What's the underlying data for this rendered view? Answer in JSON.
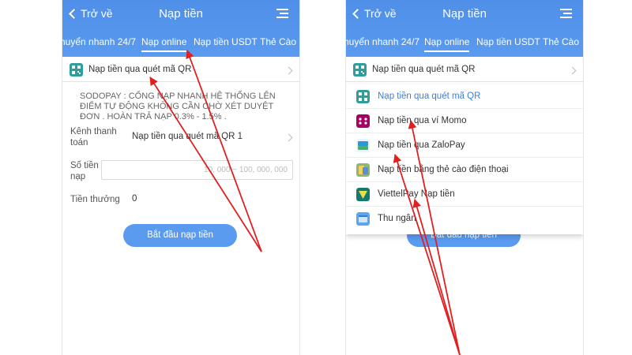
{
  "left": {
    "header": {
      "back_label": "Trở về",
      "title": "Nạp tiền"
    },
    "tabs": [
      "huyển nhanh 24/7",
      "Nạp online",
      "Nạp tiền USDT",
      "Thẻ Cào"
    ],
    "selected_method": "Nạp tiền qua quét mã QR",
    "notice": "SODOPAY : CỔNG NẠP NHANH HỆ THỐNG LÊN ĐIỂM TỰ ĐỘNG KHÔNG CẦN CHỜ XÉT DUYỆT ĐƠN . HOÀN TRẢ NẠP 0.3% - 1.5% .",
    "channel_label": "Kênh thanh toán",
    "channel_value": "Nạp tiền qua quét mã QR 1",
    "amount_label": "Số tiền nạp",
    "amount_placeholder": "10, 000 ~ 100, 000, 000",
    "bonus_label": "Tiền thưởng",
    "bonus_value": "0",
    "start_button": "Bắt đầu nạp tiền"
  },
  "right": {
    "header": {
      "back_label": "Trở về",
      "title": "Nạp tiền"
    },
    "tabs": [
      "huyển nhanh 24/7",
      "Nạp online",
      "Nạp tiền USDT",
      "Thẻ Cào"
    ],
    "selected_method": "Nạp tiền qua quét mã QR",
    "dropdown": [
      {
        "label": "Nạp tiền qua quét mã QR",
        "icon": "qr-icon"
      },
      {
        "label": "Nạp tiền qua ví Momo",
        "icon": "momo-icon"
      },
      {
        "label": "Nạp tiền qua ZaloPay",
        "icon": "zalopay-icon"
      },
      {
        "label": "Nạp tiền bằng thẻ cào điện thoại",
        "icon": "phone-card-icon"
      },
      {
        "label": "ViettelPay Nạp tiền",
        "icon": "viettelpay-icon"
      },
      {
        "label": "Thu ngân",
        "icon": "cashier-icon"
      }
    ],
    "start_button_partial": "Bắt đầu nạp tiền"
  },
  "colors": {
    "header_blue": "#5a9bf0",
    "arrow_red": "#e02020",
    "selected_text": "#3b7fdc"
  }
}
